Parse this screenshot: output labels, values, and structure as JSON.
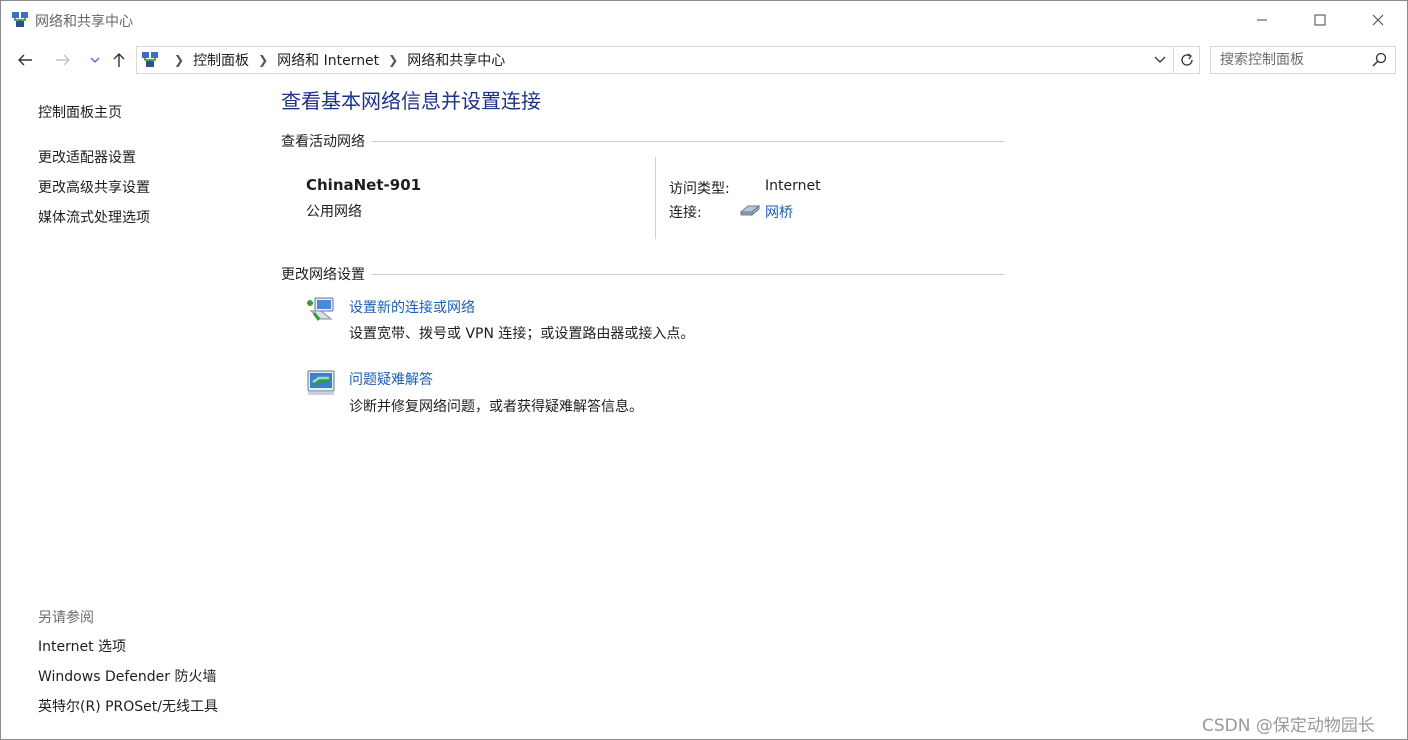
{
  "window": {
    "title": "网络和共享中心"
  },
  "address": {
    "crumbs": [
      "控制面板",
      "网络和 Internet",
      "网络和共享中心"
    ]
  },
  "search": {
    "placeholder": "搜索控制面板"
  },
  "sidebar": {
    "home": "控制面板主页",
    "links": [
      "更改适配器设置",
      "更改高级共享设置",
      "媒体流式处理选项"
    ],
    "see_also_title": "另请参阅",
    "see_also": [
      "Internet 选项",
      "Windows Defender 防火墙",
      "英特尔(R) PROSet/无线工具"
    ]
  },
  "main": {
    "title": "查看基本网络信息并设置连接",
    "active_heading": "查看活动网络",
    "network": {
      "name": "ChinaNet-901",
      "type": "公用网络",
      "access_label": "访问类型:",
      "access_value": "Internet",
      "connection_label": "连接:",
      "connection_value": "网桥"
    },
    "change_heading": "更改网络设置",
    "tasks": [
      {
        "link": "设置新的连接或网络",
        "desc": "设置宽带、拨号或 VPN 连接；或设置路由器或接入点。",
        "icon": "new-connection-icon"
      },
      {
        "link": "问题疑难解答",
        "desc": "诊断并修复网络问题，或者获得疑难解答信息。",
        "icon": "troubleshoot-icon"
      }
    ]
  },
  "watermark": "CSDN @保定动物园长",
  "colors": {
    "link": "#1a5fb4",
    "title": "#1e3287",
    "muted": "#6d6d6d"
  }
}
